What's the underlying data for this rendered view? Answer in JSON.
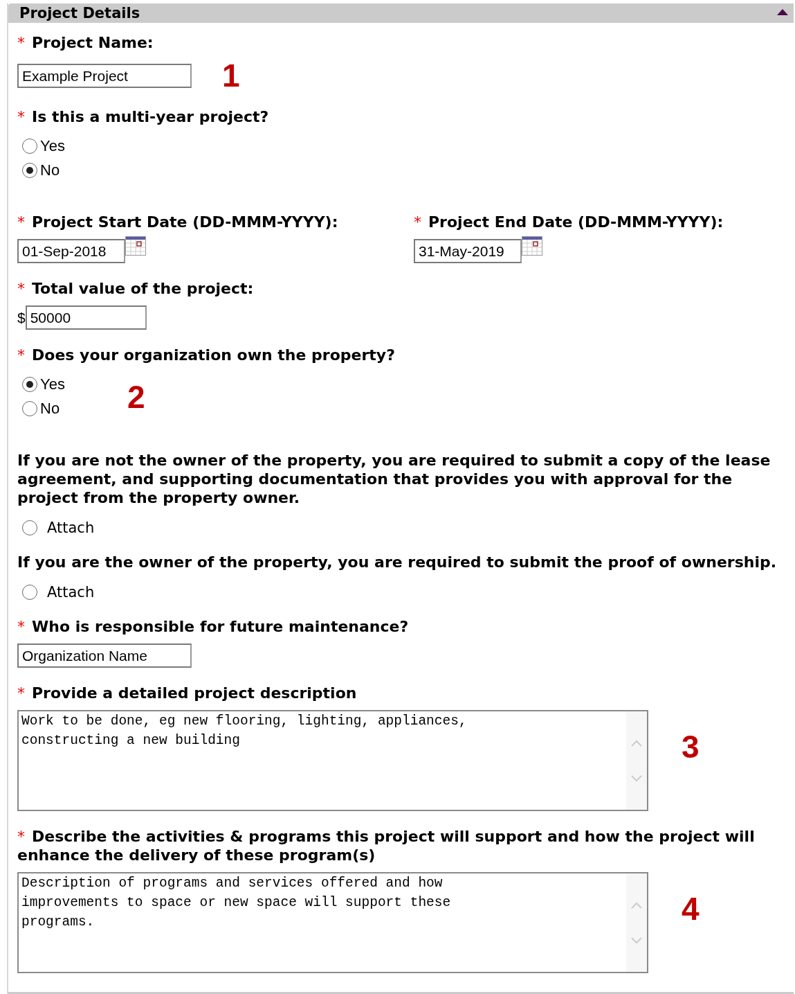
{
  "panel": {
    "title": "Project Details",
    "expanded": true
  },
  "fields": [
    {
      "kind": "text",
      "marker": "*",
      "label": "Project Name:",
      "value": "Example Project",
      "callout": "1"
    },
    {
      "kind": "radio",
      "marker": "*",
      "label": "Is this a multi-year project?",
      "options": [
        {
          "label": "Yes",
          "selected": false
        },
        {
          "label": "No",
          "selected": true
        }
      ]
    },
    {
      "kind": "dates",
      "items": [
        {
          "marker": "*",
          "label": "Project Start Date (DD-MMM-YYYY):",
          "value": "01-Sep-2018"
        },
        {
          "marker": "*",
          "label": "Project End Date (DD-MMM-YYYY):",
          "value": "31-May-2019"
        }
      ]
    },
    {
      "kind": "money",
      "marker": "*",
      "label": "Total value of the project:",
      "prefix": "$",
      "value": "50000"
    },
    {
      "kind": "radio",
      "marker": "*",
      "label": "Does your organization own the property?",
      "options": [
        {
          "label": "Yes",
          "selected": true
        },
        {
          "label": "No",
          "selected": false
        }
      ],
      "callout": "2"
    },
    {
      "kind": "attach",
      "label": "If you are not the owner of the property, you are required to submit a copy of the lease agreement, and supporting documentation that provides you with approval for the project from the property owner.",
      "options": [
        {
          "label": "Attach",
          "selected": false
        }
      ]
    },
    {
      "kind": "attach",
      "label": "If you are the owner of the property, you are required to submit the proof of ownership.",
      "options": [
        {
          "label": "Attach",
          "selected": false
        }
      ]
    },
    {
      "kind": "text",
      "marker": "*",
      "label": "Who is responsible for future maintenance?",
      "value": "Organization Name"
    },
    {
      "kind": "textarea",
      "marker": "*",
      "label": "Provide a detailed project description",
      "lines": [
        "Work to be done, eg new flooring, lighting, appliances,",
        "constructing a new building"
      ],
      "callout": "3"
    },
    {
      "kind": "textarea",
      "marker": "*",
      "label": "Describe the activities & programs this project will support and how the project will enhance the delivery of these program(s)",
      "lines": [
        "Description of programs and services offered and how",
        "improvements to space or new space will support these",
        "programs."
      ],
      "callout": "4"
    }
  ]
}
